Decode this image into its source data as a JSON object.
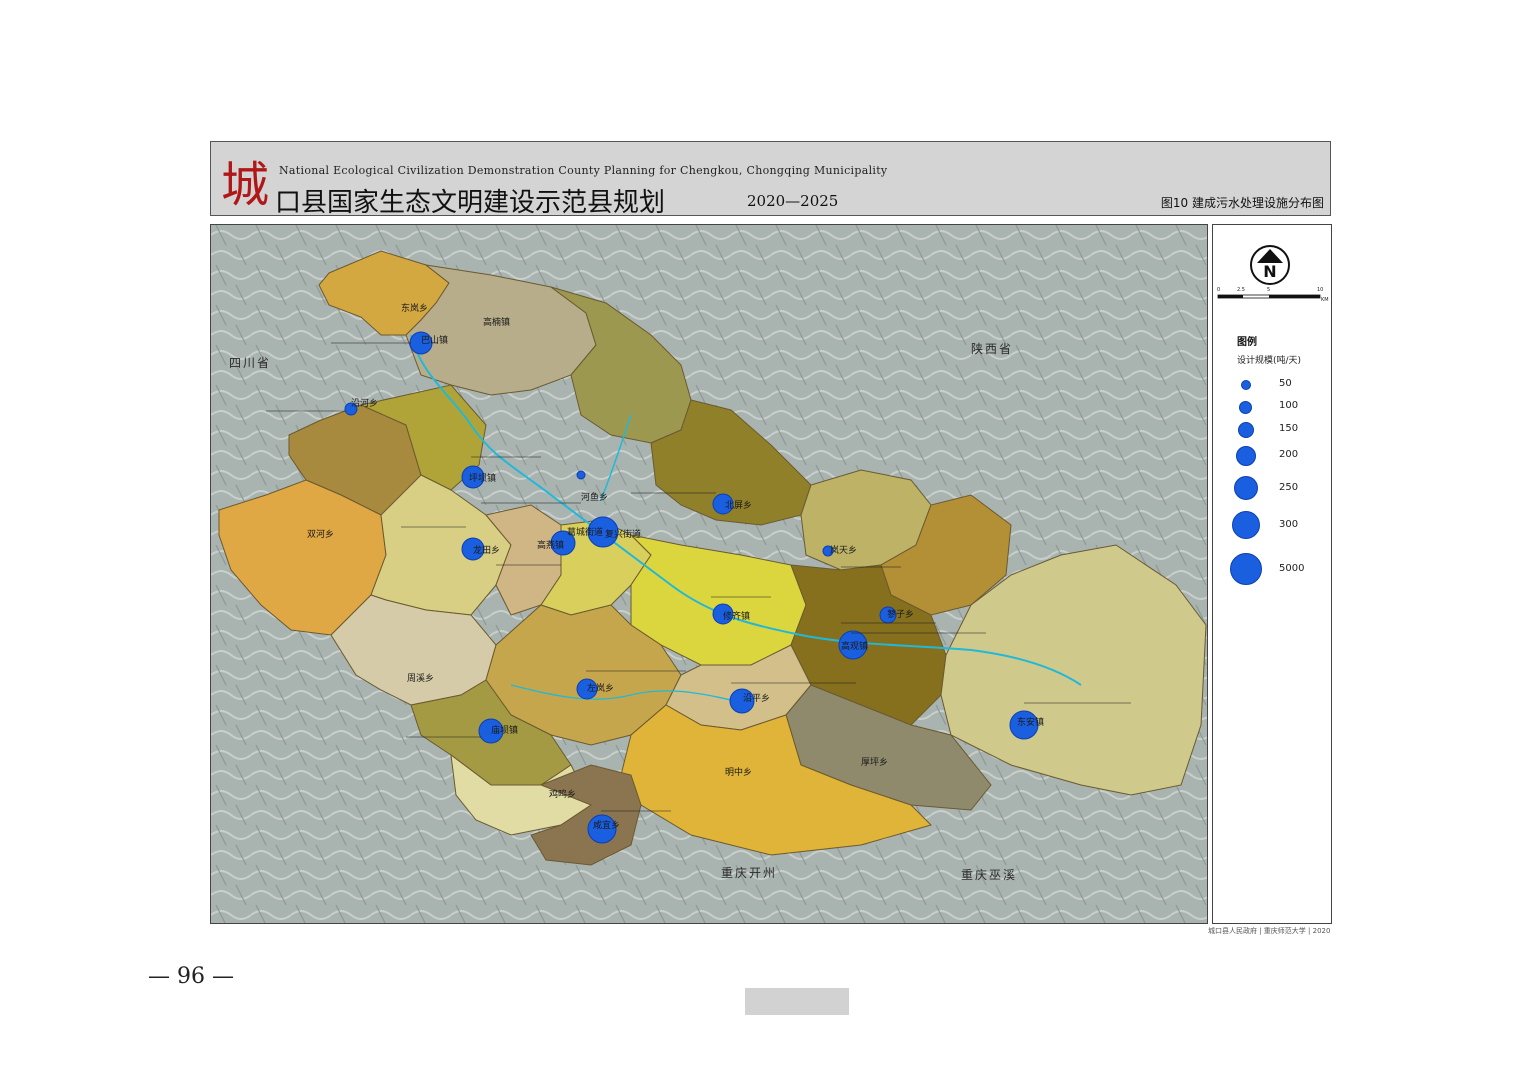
{
  "header": {
    "logo_char": "城",
    "subtitle": "National Ecological Civilization Demonstration County Planning for Chengkou, Chongqing Municipality",
    "title": "口县国家生态文明建设示范县规划",
    "years": "2020—2025",
    "figure_title": "图10  建成污水处理设施分布图"
  },
  "neighbors": {
    "sichuan": "四川省",
    "shaanxi": "陕西省",
    "kaizhou": "重庆开州",
    "wuxi": "重庆巫溪"
  },
  "towns": {
    "donganxiang_n": "东岚乡",
    "gaoguan": "高楠镇",
    "bashan": "巴山镇",
    "shuanghe": "双河乡",
    "xiushi": "修齐镇",
    "gaoyan": "高燕镇",
    "jiancheng": "葛城街道",
    "fuxing": "复兴街道",
    "beiping": "北屏乡",
    "lanzhou": "岚天乡",
    "heyu": "河鱼乡",
    "gaoguan_town": "高观镇",
    "zhouxi": "周溪乡",
    "zuolan": "左岚乡",
    "ganfu": "庙坝镇",
    "yanping": "沿平乡",
    "mingzhong": "明中乡",
    "houping": "厚坪乡",
    "donganzhen": "东安镇",
    "jixi": "鸡鸣乡",
    "xianshan": "咸宜乡",
    "pengxi": "蓼子乡",
    "jinyuan": "坪坝镇",
    "shuanghe_n": "沿河乡",
    "longtian": "龙田乡"
  },
  "legend": {
    "title": "图例",
    "subtitle": "设计规模(吨/天)",
    "items": [
      "50",
      "100",
      "150",
      "200",
      "250",
      "300",
      "5000"
    ]
  },
  "scale_bar": {
    "ticks": [
      "0",
      "2.5",
      "5",
      "10"
    ],
    "unit": "KM"
  },
  "compass": {
    "letter": "N"
  },
  "credit": "城口县人民政府 | 重庆师范大学 | 2020",
  "page_number": "— 96 —",
  "colors": {
    "facility": "#1a5fe0",
    "river": "#22b8d8",
    "boundary": "#6a5a30",
    "header_bg": "#d4d4d4",
    "logo": "#b01818"
  }
}
